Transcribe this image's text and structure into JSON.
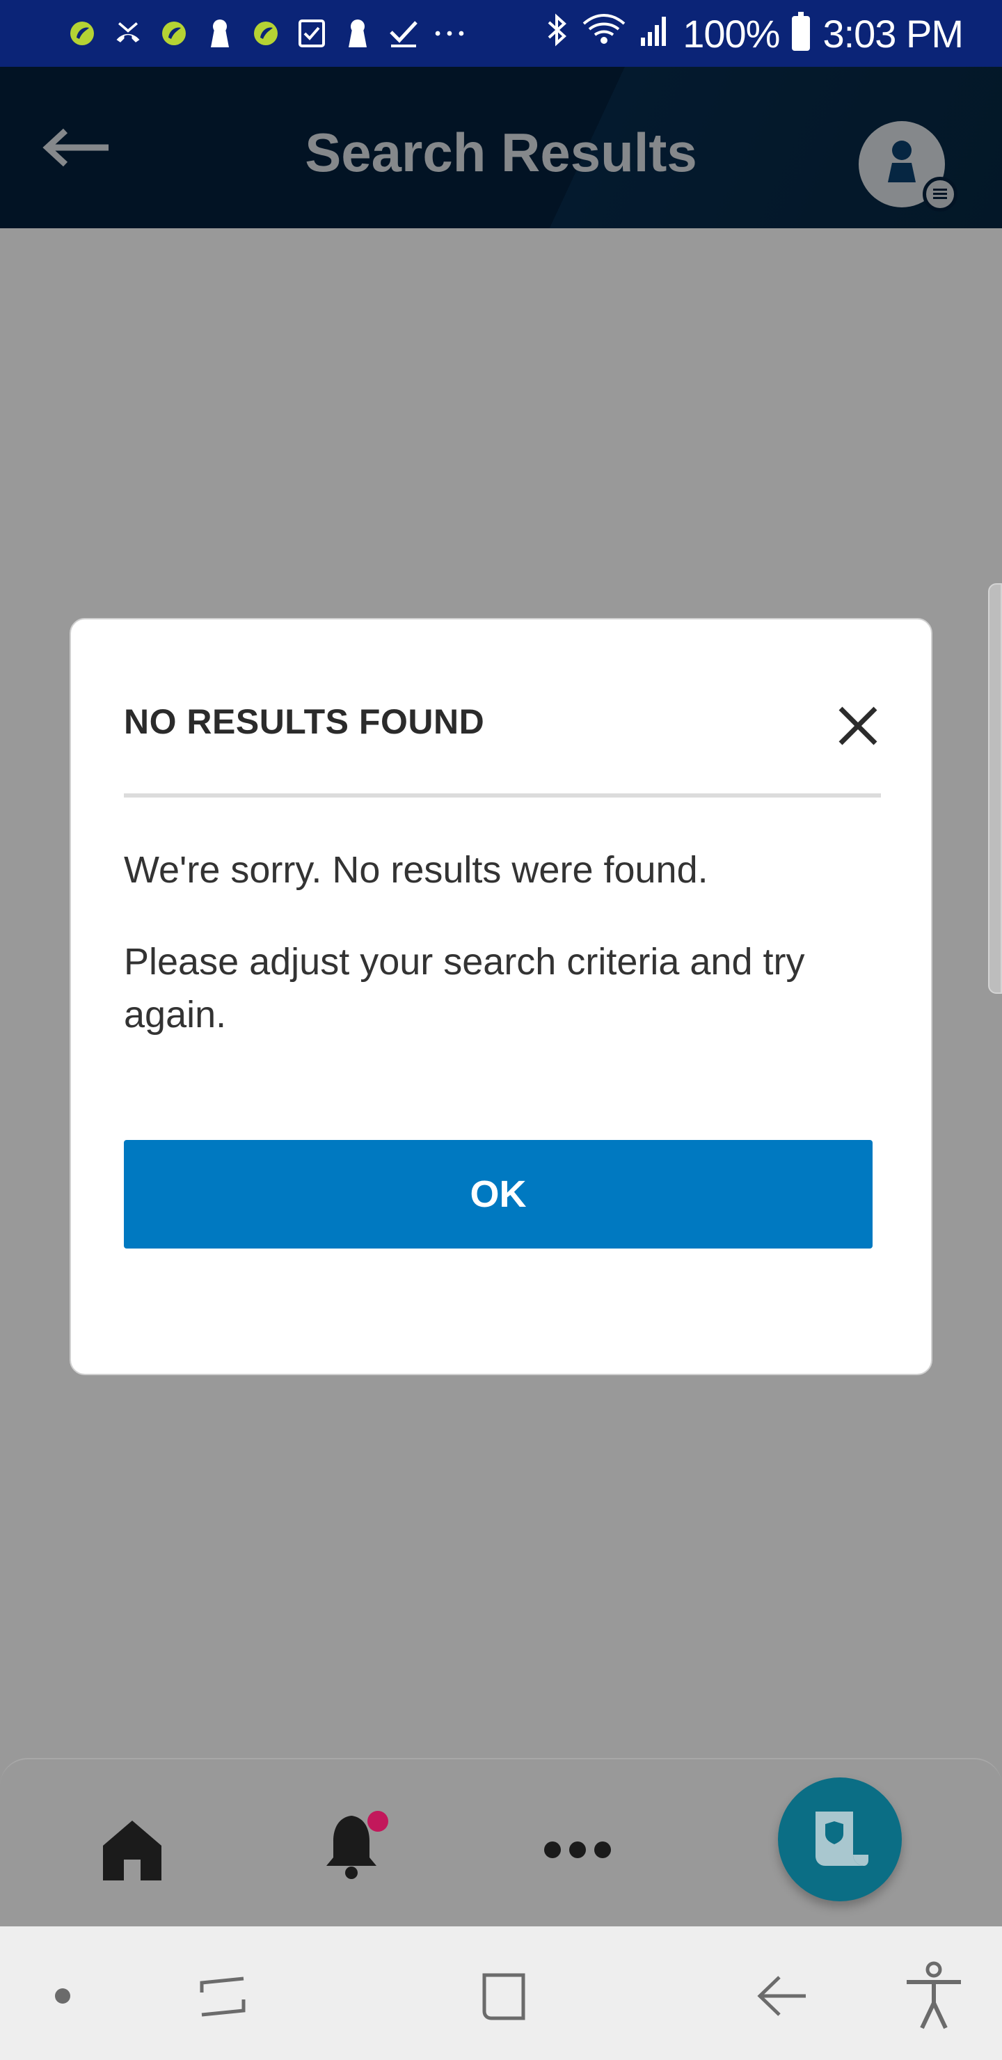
{
  "status_bar": {
    "icons": [
      "leaf-app-icon",
      "missed-call-icon",
      "leaf-app-icon",
      "keyhole-icon",
      "leaf-app-icon",
      "checkbox-icon",
      "keyhole-icon",
      "check-icon",
      "more-dots-icon",
      "bluetooth-icon",
      "wifi-icon",
      "signal-icon",
      "battery-icon"
    ],
    "battery_text": "100%",
    "time": "3:03 PM"
  },
  "app_bar": {
    "title": "Search Results"
  },
  "dialog": {
    "title": "NO RESULTS FOUND",
    "message_1": "We're sorry. No results were found.",
    "message_2": "Please adjust your search criteria and try again.",
    "ok_label": "OK"
  },
  "bottom_nav": {
    "items": [
      "home-icon",
      "bell-icon",
      "more-icon",
      "policy-document-icon"
    ],
    "notification_dot_color": "#c2185b"
  },
  "colors": {
    "status_bar": "#0b2477",
    "app_bar": "#031f3a",
    "primary_button": "#0079c1",
    "fab": "#0b6e85",
    "overlay": "#999999"
  }
}
